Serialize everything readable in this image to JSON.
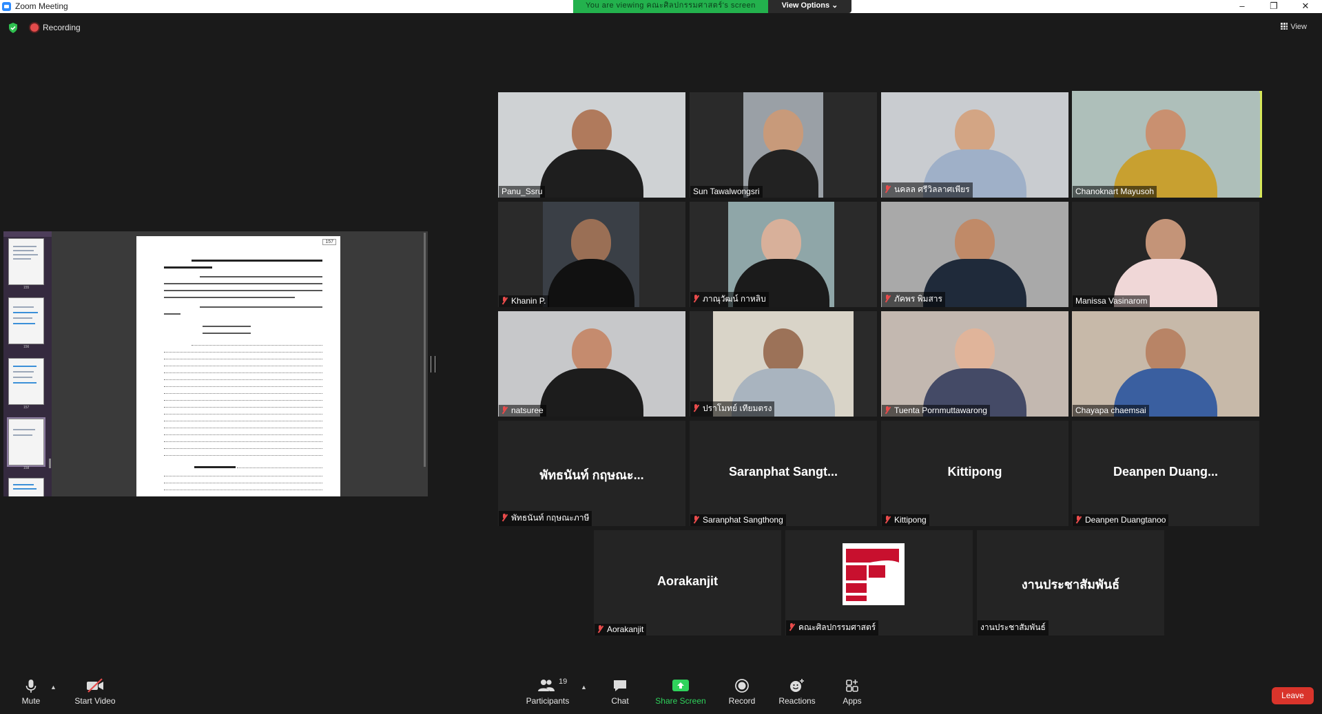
{
  "window": {
    "title": "Zoom Meeting",
    "viewing_banner": "You are viewing คณะศิลปกรรมศาสตร์'s screen",
    "view_options": "View Options ⌄",
    "minimize": "–",
    "restore": "❐",
    "close": "✕"
  },
  "status": {
    "recording_label": "Recording",
    "view_label": "View"
  },
  "shared_doc": {
    "page_number": "157",
    "thumb_numbers": [
      "155",
      "156",
      "157",
      "158"
    ]
  },
  "participants": [
    {
      "name": "Panu_Ssru",
      "muted": false,
      "video": true
    },
    {
      "name": "Sun Tawalwongsri",
      "muted": false,
      "video": true
    },
    {
      "name": "นคลล ศรีวิลลาศเพียร",
      "muted": true,
      "video": true
    },
    {
      "name": "Chanoknart Mayusoh",
      "muted": false,
      "video": true,
      "active_speaker": true
    },
    {
      "name": "Khanin P.",
      "muted": true,
      "video": true
    },
    {
      "name": "ภาณุวัฒน์ กาหลิบ",
      "muted": true,
      "video": true
    },
    {
      "name": "ภัคพร พิมสาร",
      "muted": true,
      "video": true
    },
    {
      "name": "Manissa  Vasinarom",
      "muted": false,
      "video": true
    },
    {
      "name": "natsuree",
      "muted": true,
      "video": true
    },
    {
      "name": "ปราโมทย์ เทียมตรง",
      "muted": true,
      "video": true
    },
    {
      "name": "Tuenta Pornmuttawarong",
      "muted": true,
      "video": true
    },
    {
      "name": "Chayapa chaemsai",
      "muted": false,
      "video": true
    },
    {
      "name": "พัทธนันท์ กฤษณะภาษี",
      "display": "พัทธนันท์ กฤษณะ...",
      "muted": true,
      "video": false
    },
    {
      "name": "Saranphat Sangthong",
      "display": "Saranphat Sangt...",
      "muted": true,
      "video": false
    },
    {
      "name": "Kittipong",
      "display": "Kittipong",
      "muted": true,
      "video": false
    },
    {
      "name": "Deanpen Duangtanoo",
      "display": "Deanpen Duang...",
      "muted": true,
      "video": false
    },
    {
      "name": "Aorakanjit",
      "display": "Aorakanjit",
      "muted": true,
      "video": false
    },
    {
      "name": "คณะศิลปกรรมศาสตร์",
      "muted": true,
      "video": false,
      "logo": true
    },
    {
      "name": "งานประชาสัมพันธ์",
      "display": "งานประชาสัมพันธ์",
      "muted": false,
      "video": false
    }
  ],
  "toolbar": {
    "mute": "Mute",
    "start_video": "Start Video",
    "participants": "Participants",
    "participant_count": "19",
    "chat": "Chat",
    "share_screen": "Share Screen",
    "record": "Record",
    "reactions": "Reactions",
    "apps": "Apps",
    "leave": "Leave"
  },
  "colors": {
    "accent_green": "#23b14d",
    "active_speaker": "#d7e85a",
    "leave_red": "#d9342b",
    "muted_red": "#e84b4b"
  }
}
